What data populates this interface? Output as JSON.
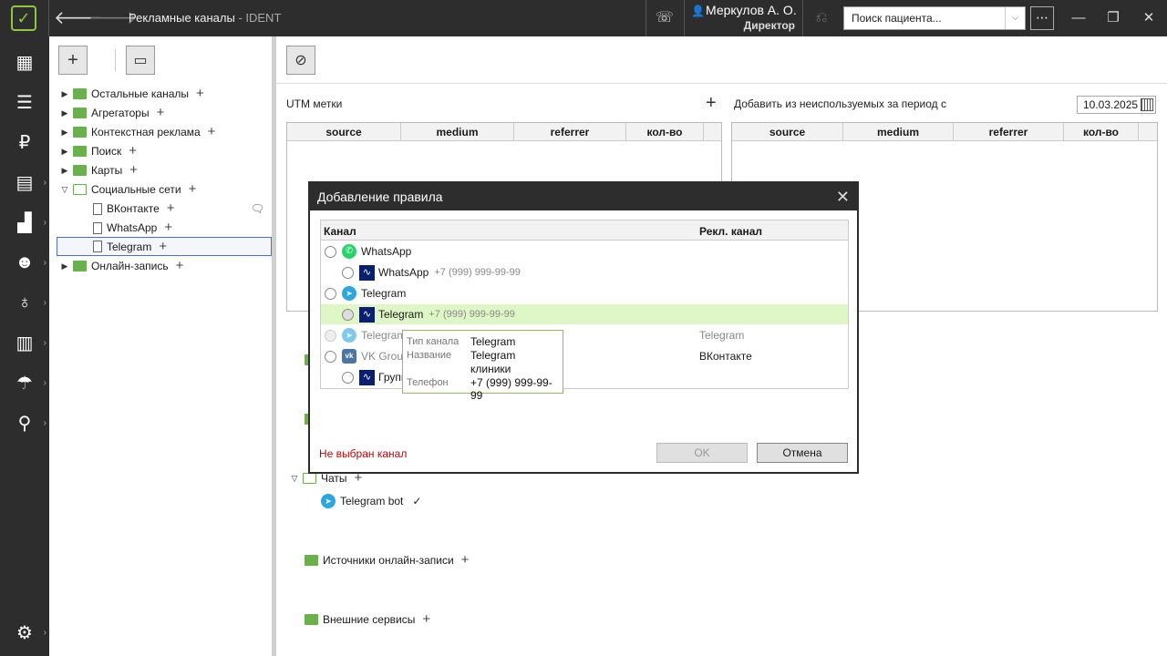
{
  "titlebar": {
    "title": "Рекламные каналы",
    "app": " - IDENT",
    "user_name": "Меркулов А. О.",
    "user_role": "Директор",
    "search_placeholder": "Поиск пациента..."
  },
  "tree": {
    "items": [
      {
        "label": "Остальные каналы"
      },
      {
        "label": "Агрегаторы"
      },
      {
        "label": "Контекстная реклама"
      },
      {
        "label": "Поиск"
      },
      {
        "label": "Карты"
      },
      {
        "label": "Социальные сети"
      },
      {
        "label": "ВКонтакте"
      },
      {
        "label": "WhatsApp"
      },
      {
        "label": "Telegram"
      },
      {
        "label": "Онлайн-запись"
      }
    ]
  },
  "utm": {
    "label": "UTM метки",
    "add_unused_label": "Добавить из неиспользуемых за период с",
    "date": "10.03.2025",
    "columns": [
      "source",
      "medium",
      "referrer",
      "кол-во"
    ]
  },
  "groups": {
    "chats": "Чаты",
    "telegram_bot": "Telegram bot",
    "check": "✓",
    "online_sources": "Источники онлайн-записи",
    "external": "Внешние сервисы"
  },
  "dialog": {
    "title": "Добавление правила",
    "col_channel": "Канал",
    "col_ad_channel": "Рекл. канал",
    "rows": [
      {
        "label": "WhatsApp",
        "phone": "",
        "ad": ""
      },
      {
        "label": "WhatsApp",
        "phone": "+7 (999) 999-99-99",
        "ad": ""
      },
      {
        "label": "Telegram",
        "phone": "",
        "ad": ""
      },
      {
        "label": "Telegram",
        "phone": "+7 (999) 999-99-99",
        "ad": ""
      },
      {
        "label": "Telegram",
        "phone": "",
        "ad": "Telegram"
      },
      {
        "label": "VK Group",
        "phone": "",
        "ad": "ВКонтакте"
      },
      {
        "label": "Групп",
        "phone": "",
        "ad": ""
      }
    ],
    "error": "Не выбран канал",
    "ok": "OK",
    "cancel": "Отмена"
  },
  "tooltip": {
    "type_key": "Тип канала",
    "type_val": "Telegram",
    "name_key": "Название",
    "name_val1": "Telegram",
    "name_val2": "клиники",
    "phone_key": "Телефон",
    "phone_val": "+7 (999) 999-99-99"
  }
}
